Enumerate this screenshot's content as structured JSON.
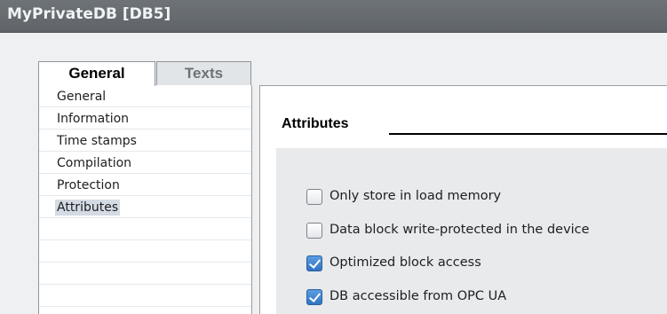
{
  "window": {
    "title": "MyPrivateDB [DB5]"
  },
  "tabs": [
    {
      "label": "General",
      "active": true
    },
    {
      "label": "Texts",
      "active": false
    }
  ],
  "nav": {
    "items": [
      {
        "label": "General"
      },
      {
        "label": "Information"
      },
      {
        "label": "Time stamps"
      },
      {
        "label": "Compilation"
      },
      {
        "label": "Protection"
      },
      {
        "label": "Attributes",
        "selected": true
      }
    ]
  },
  "section": {
    "title": "Attributes",
    "options": [
      {
        "label": "Only store in load memory",
        "checked": false
      },
      {
        "label": "Data block write-protected in the device",
        "checked": false
      },
      {
        "label": "Optimized block access",
        "checked": true
      },
      {
        "label": "DB accessible from OPC UA",
        "checked": true
      }
    ]
  },
  "colors": {
    "titlebar": "#636869",
    "checkbox_checked": "#2f74c4",
    "nav_selected": "#d3dbe4"
  }
}
